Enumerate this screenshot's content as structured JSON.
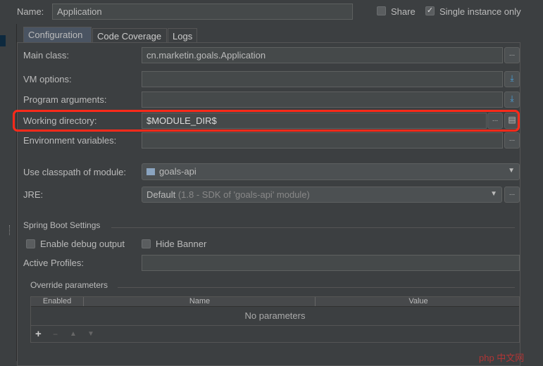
{
  "name": {
    "label": "Name:",
    "value": "Application"
  },
  "share": {
    "label": "Share",
    "checked": false
  },
  "single_instance": {
    "label": "Single instance only",
    "checked": true
  },
  "tabs": [
    {
      "label": "Configuration",
      "active": true
    },
    {
      "label": "Code Coverage"
    },
    {
      "label": "Logs"
    }
  ],
  "fields": {
    "main_class": {
      "label": "Main class:",
      "value": "cn.marketin.goals.Application",
      "button": "..."
    },
    "vm_options": {
      "label": "VM options:",
      "value": ""
    },
    "program_arguments": {
      "label": "Program arguments:",
      "value": ""
    },
    "working_directory": {
      "label": "Working directory:",
      "value": "$MODULE_DIR$",
      "button": "..."
    },
    "environment_variables": {
      "label": "Environment variables:",
      "value": "",
      "button": "..."
    },
    "classpath_module": {
      "label": "Use classpath of module:",
      "value": "goals-api"
    },
    "jre": {
      "label": "JRE:",
      "value": "Default",
      "hint": "(1.8 - SDK of 'goals-api' module)",
      "button": "..."
    }
  },
  "spring_boot": {
    "title": "Spring Boot Settings",
    "enable_debug": {
      "label": "Enable debug output",
      "checked": false
    },
    "hide_banner": {
      "label": "Hide Banner",
      "checked": false
    },
    "active_profiles": {
      "label": "Active Profiles:",
      "value": ""
    }
  },
  "override": {
    "title": "Override parameters",
    "columns": [
      "Enabled",
      "Name",
      "Value"
    ],
    "empty_text": "No parameters",
    "toolbar": [
      "+",
      "−",
      "▲",
      "▼"
    ]
  },
  "highlight_color": "#ff2a1a",
  "watermark": "php 中文网"
}
